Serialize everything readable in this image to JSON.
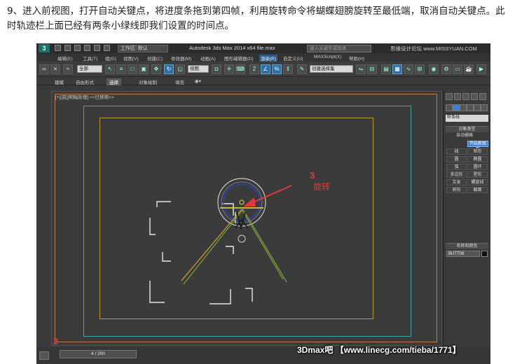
{
  "instruction": "9、进入前视图，打开自动关键点，将进度条拖到第四帧，利用旋转命令将蝴蝶翅膀旋转至最低端，取消自动关键点。此时轨迹栏上面已经有两条小绿线即我们设置的时间点。",
  "app": {
    "logo": "3",
    "workspace": "工作区: 默认",
    "window_title": "Autodesk 3ds Max  2014 x64    file.max",
    "search_placeholder": "键入关键字或短语",
    "watermark_top": "思缘设计论坛 www.MISSYUAN.COM"
  },
  "menus": [
    "编辑(E)",
    "工具(T)",
    "组(G)",
    "视图(V)",
    "创建(C)",
    "修改器(M)",
    "动画(A)",
    "图形编辑器(D)",
    "渲染(R)",
    "自定义(U)",
    "MAXScript(X)",
    "帮助(H)"
  ],
  "active_menu_index": 8,
  "toolbar": {
    "filter_dropdown": "全部",
    "view_dropdown": "视图",
    "selection_set": "创建选择集",
    "icons": [
      "link-icon",
      "unlink-icon",
      "bind-space-warp-icon",
      "select-icon",
      "select-by-name-icon",
      "rect-select-icon",
      "window-crossing-icon",
      "move-icon",
      "rotate-icon",
      "scale-icon",
      "snap-icon",
      "angle-snap-icon",
      "percent-snap-icon",
      "spinner-snap-icon",
      "mirror-icon",
      "align-icon",
      "layer-icon",
      "curve-editor-icon",
      "material-editor-icon",
      "render-setup-icon",
      "render-icon"
    ]
  },
  "ribbon_tabs": [
    "建模",
    "自由形式",
    "选择",
    "对象绘制",
    "填充"
  ],
  "active_ribbon_index": 2,
  "viewport": {
    "label": "[+][前][明暗处理]",
    "chevron": "<<已禁用>>",
    "annotation_number": "3",
    "annotation_text": "旋转"
  },
  "command_panel": {
    "dropdown": "样条线",
    "object_type_header": "对象类型",
    "auto_grid": "自动栅格",
    "start_new_shape": "开始新图形",
    "buttons": [
      "线",
      "矩形",
      "圆",
      "椭圆",
      "弧",
      "圆环",
      "多边形",
      "星形",
      "文本",
      "螺旋线",
      "卵形",
      "截面"
    ],
    "name_color_header": "名称和颜色",
    "object_name": "BUTT08",
    "icons": [
      "create-tab-icon",
      "modify-tab-icon",
      "hierarchy-tab-icon",
      "motion-tab-icon",
      "display-tab-icon",
      "utilities-tab-icon"
    ]
  },
  "timeline": {
    "current_frame": 4,
    "total_frames": 200,
    "slider_label": "4 / 200",
    "annotation_number": "2"
  },
  "watermark_bottom": "3Dmax吧 【www.linecg.com/tieba/1771】",
  "colors": {
    "accent_blue": "#2a6fb0",
    "annotation_red": "#e03a3a",
    "safe_frame_orange": "#c0794c",
    "safe_frame_teal": "#3aa8a0",
    "safe_frame_yellow": "#b89a30"
  }
}
